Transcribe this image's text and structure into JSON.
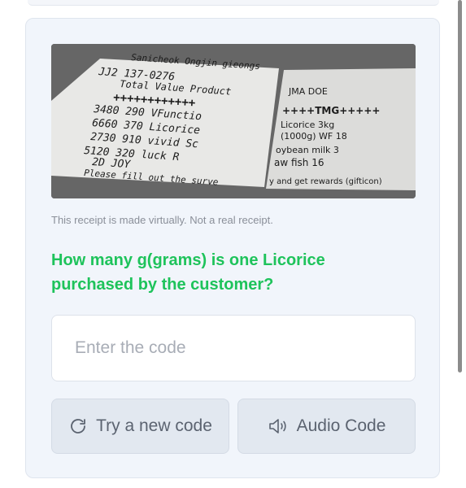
{
  "captcha": {
    "receipt_lines_left": [
      "Sanichеok Ongjin gieongs",
      "JJ2 137-0276",
      "Total Value Product",
      "++++++++++++",
      "3480 290 VFunctio",
      "6660 370 Licorice",
      "2730 910 vivid Sc",
      "5120 320 luck R",
      "2D JOY",
      "Please fill out the surve"
    ],
    "receipt_lines_right": [
      "JMA DOE",
      "++++TMG+++++",
      "Licorice 3kg",
      "(1000g) WF 18",
      "oybean milk 3",
      "aw fish 16",
      "y and get rewards (gifticon)"
    ],
    "disclaimer": "This receipt is made virtually. Not a real receipt.",
    "question": "How many g(grams) is one Licorice purchased by the customer?",
    "input_placeholder": "Enter the code",
    "new_code_label": "Try a new code",
    "audio_label": "Audio Code",
    "accent_color": "#1ec35b",
    "icons": {
      "refresh": "refresh-icon",
      "audio": "speaker-icon"
    }
  }
}
